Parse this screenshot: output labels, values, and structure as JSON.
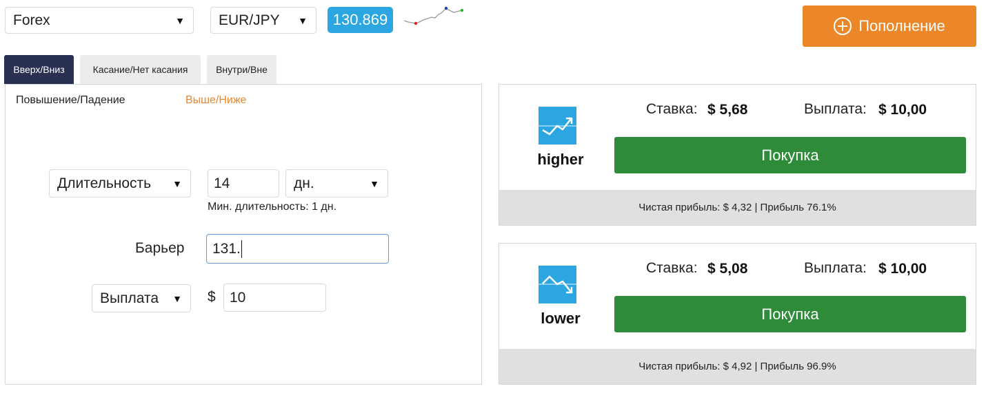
{
  "top": {
    "market_select": "Forex",
    "pair_select": "EUR/JPY",
    "price": "130.869",
    "deposit_label": "Пополнение"
  },
  "tabs": [
    {
      "label": "Вверх/Вниз",
      "active": true
    },
    {
      "label": "Касание/Нет касания",
      "active": false
    },
    {
      "label": "Внутри/Вне",
      "active": false
    }
  ],
  "subtabs": [
    "Повышение/Падение",
    "Выше/Ниже"
  ],
  "form": {
    "duration_select": "Длительность",
    "duration_value": "14",
    "duration_unit": "дн.",
    "min_duration_hint": "Мин. длительность: 1 дн.",
    "barrier_label": "Барьер",
    "barrier_value": "131.",
    "payout_select": "Выплата",
    "currency_symbol": "$",
    "payout_value": "10"
  },
  "contracts": [
    {
      "direction": "higher",
      "icon": "trend-up-icon",
      "stake_label": "Ставка:",
      "stake_value": "$ 5,68",
      "payout_label": "Выплата:",
      "payout_value": "$ 10,00",
      "buy_label": "Покупка",
      "footer": "Чистая прибыль: $ 4,32 | Прибыль 76.1%"
    },
    {
      "direction": "lower",
      "icon": "trend-down-icon",
      "stake_label": "Ставка:",
      "stake_value": "$ 5,08",
      "payout_label": "Выплата:",
      "payout_value": "$ 10,00",
      "buy_label": "Покупка",
      "footer": "Чистая прибыль: $ 4,92 | Прибыль 96.9%"
    }
  ],
  "colors": {
    "accent_orange": "#ec8729",
    "buy_green": "#2e8b39",
    "price_blue": "#2ca6e0",
    "active_tab": "#2a3052",
    "icon_blue": "#2ca6e0"
  }
}
